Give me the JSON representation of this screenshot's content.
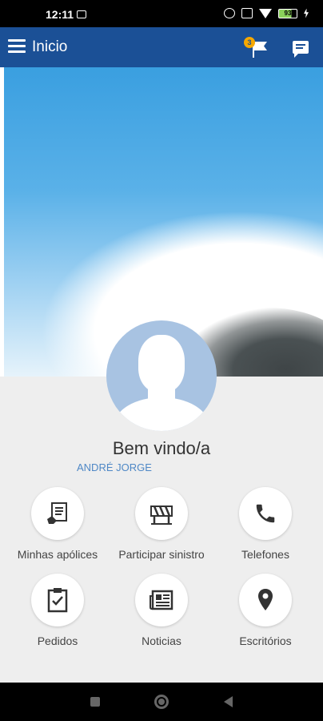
{
  "status_bar": {
    "time": "12:11",
    "battery": "93"
  },
  "app_bar": {
    "title": "Inicio",
    "notification_count": "3"
  },
  "profile": {
    "welcome": "Bem vindo/a",
    "name": "ANDRÉ JORGE"
  },
  "menu": [
    {
      "label": "Minhas apólices",
      "icon": "policy-document-icon"
    },
    {
      "label": "Participar sinistro",
      "icon": "roadblock-icon"
    },
    {
      "label": "Telefones",
      "icon": "phone-icon"
    },
    {
      "label": "Pedidos",
      "icon": "clipboard-check-icon"
    },
    {
      "label": "Noticias",
      "icon": "newspaper-icon"
    },
    {
      "label": "Escritórios",
      "icon": "location-pin-icon"
    }
  ],
  "colors": {
    "app_bar": "#1b5096",
    "accent": "#4f88c6",
    "badge": "#f6a800",
    "icon": "#333333"
  }
}
